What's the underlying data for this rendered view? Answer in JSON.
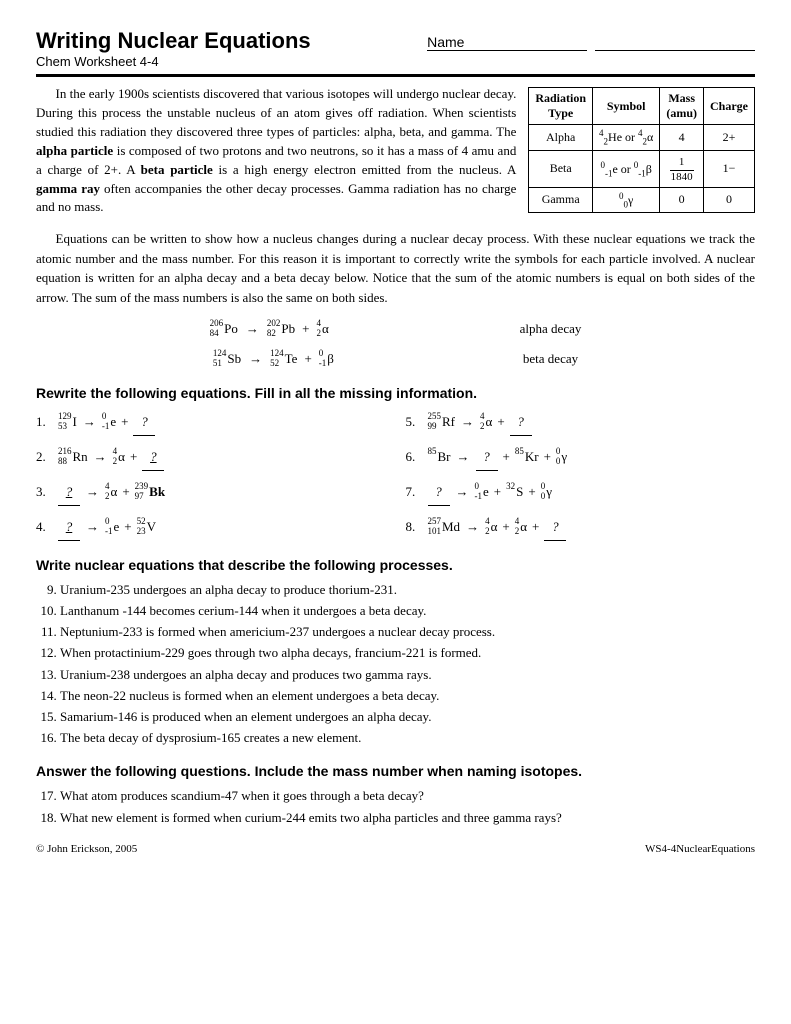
{
  "header": {
    "title": "Writing Nuclear Equations",
    "subtitle": "Chem Worksheet 4-4",
    "name_label": "Name"
  },
  "intro": {
    "paragraph1": "In the early 1900s scientists discovered that various isotopes will undergo nuclear decay. During this process the unstable nucleus of an atom gives off radiation. When scientists studied this radiation they discovered three types of particles: alpha, beta, and gamma. The alpha particle is composed of two protons and two neutrons, so it has a mass of 4 amu and a charge of 2+. A beta particle is a high energy electron emitted from the nucleus. A gamma ray often accompanies the other decay processes. Gamma radiation has no charge and no mass.",
    "paragraph2": "Equations can be written to show how a nucleus changes during a nuclear decay process. With these nuclear equations we track the atomic number and the mass number. For this reason it is important to correctly write the symbols for each particle involved. A nuclear equation is written for an alpha decay and a beta decay below. Notice that the sum of the atomic numbers is equal on both sides of the arrow. The sum of the mass numbers is also the same on both sides."
  },
  "radiation_table": {
    "headers": [
      "Radiation Type",
      "Symbol",
      "Mass (amu)",
      "Charge"
    ],
    "rows": [
      [
        "Alpha",
        "⁴₂He or ⁴₂α",
        "4",
        "2+"
      ],
      [
        "Beta",
        "⁰₋₁e or ⁰₋₁β",
        "1/1840",
        "1−"
      ],
      [
        "Gamma",
        "⁰₀γ",
        "0",
        "0"
      ]
    ]
  },
  "decay_examples": {
    "alpha": {
      "label": "alpha decay",
      "equation": "²⁰⁶₈₄Po → ²⁰²₈₂Pb + ⁴₂α"
    },
    "beta": {
      "label": "beta decay",
      "equation": "¹²⁴₅₁Sb → ¹²⁴₅₂Te + ⁰₋₁β"
    }
  },
  "section1": {
    "header": "Rewrite the following equations. Fill in all the missing information.",
    "problems": [
      {
        "num": "1.",
        "left": "¹²⁹₅₃I",
        "arrow": "→",
        "right_parts": [
          "⁰₋₁e",
          "+",
          "?"
        ]
      },
      {
        "num": "2.",
        "left": "²¹⁶₈₈Rn",
        "arrow": "→",
        "right_parts": [
          "⁴₂α",
          "+",
          "?"
        ]
      },
      {
        "num": "3.",
        "left": "?",
        "arrow": "→",
        "right_parts": [
          "⁴₂α",
          "+",
          "²³⁹₉₇Bk"
        ]
      },
      {
        "num": "4.",
        "left": "?",
        "arrow": "→",
        "right_parts": [
          "⁰₋₁e",
          "+",
          "⁵²₂₃V"
        ]
      },
      {
        "num": "5.",
        "left": "²⁵⁵₉₉Rf",
        "arrow": "→",
        "right_parts": [
          "⁴₂α",
          "+",
          "?"
        ]
      },
      {
        "num": "6.",
        "left": "⁸⁵Br",
        "arrow": "→",
        "right_parts": [
          "?",
          "+",
          "⁸⁵Kr",
          "+",
          "⁰₀γ"
        ]
      },
      {
        "num": "7.",
        "left": "?",
        "arrow": "→",
        "right_parts": [
          "⁰₋₁e",
          "+",
          "³²S",
          "+",
          "⁰₀γ"
        ]
      },
      {
        "num": "8.",
        "left": "²⁵⁷₁₀₁Md",
        "arrow": "→",
        "right_parts": [
          "⁴₂α",
          "+",
          "⁴₂α",
          "+",
          "?"
        ]
      }
    ]
  },
  "section2": {
    "header": "Write nuclear equations that describe the following processes.",
    "problems": [
      "Uranium-235 undergoes an alpha decay to produce thorium-231.",
      "Lanthanum -144 becomes cerium-144 when it undergoes a beta decay.",
      "Neptunium-233 is formed when americium-237 undergoes a nuclear decay process.",
      "When protactinium-229 goes through two alpha decays, francium-221 is formed.",
      "Uranium-238 undergoes an alpha decay and produces two gamma rays.",
      "The neon-22 nucleus is formed when an element undergoes a beta decay.",
      "Samarium-146 is produced when an element undergoes an alpha decay.",
      "The beta decay of dysprosium-165 creates a new element."
    ],
    "start_num": 9
  },
  "section3": {
    "header": "Answer the following questions. Include the mass number when naming isotopes.",
    "problems": [
      "What atom produces scandium-47 when it goes through a beta decay?",
      "What new element is formed when curium-244 emits two alpha particles and three gamma rays?"
    ],
    "start_num": 17
  },
  "footer": {
    "copyright": "© John Erickson, 2005",
    "worksheet_id": "WS4-4NuclearEquations"
  }
}
